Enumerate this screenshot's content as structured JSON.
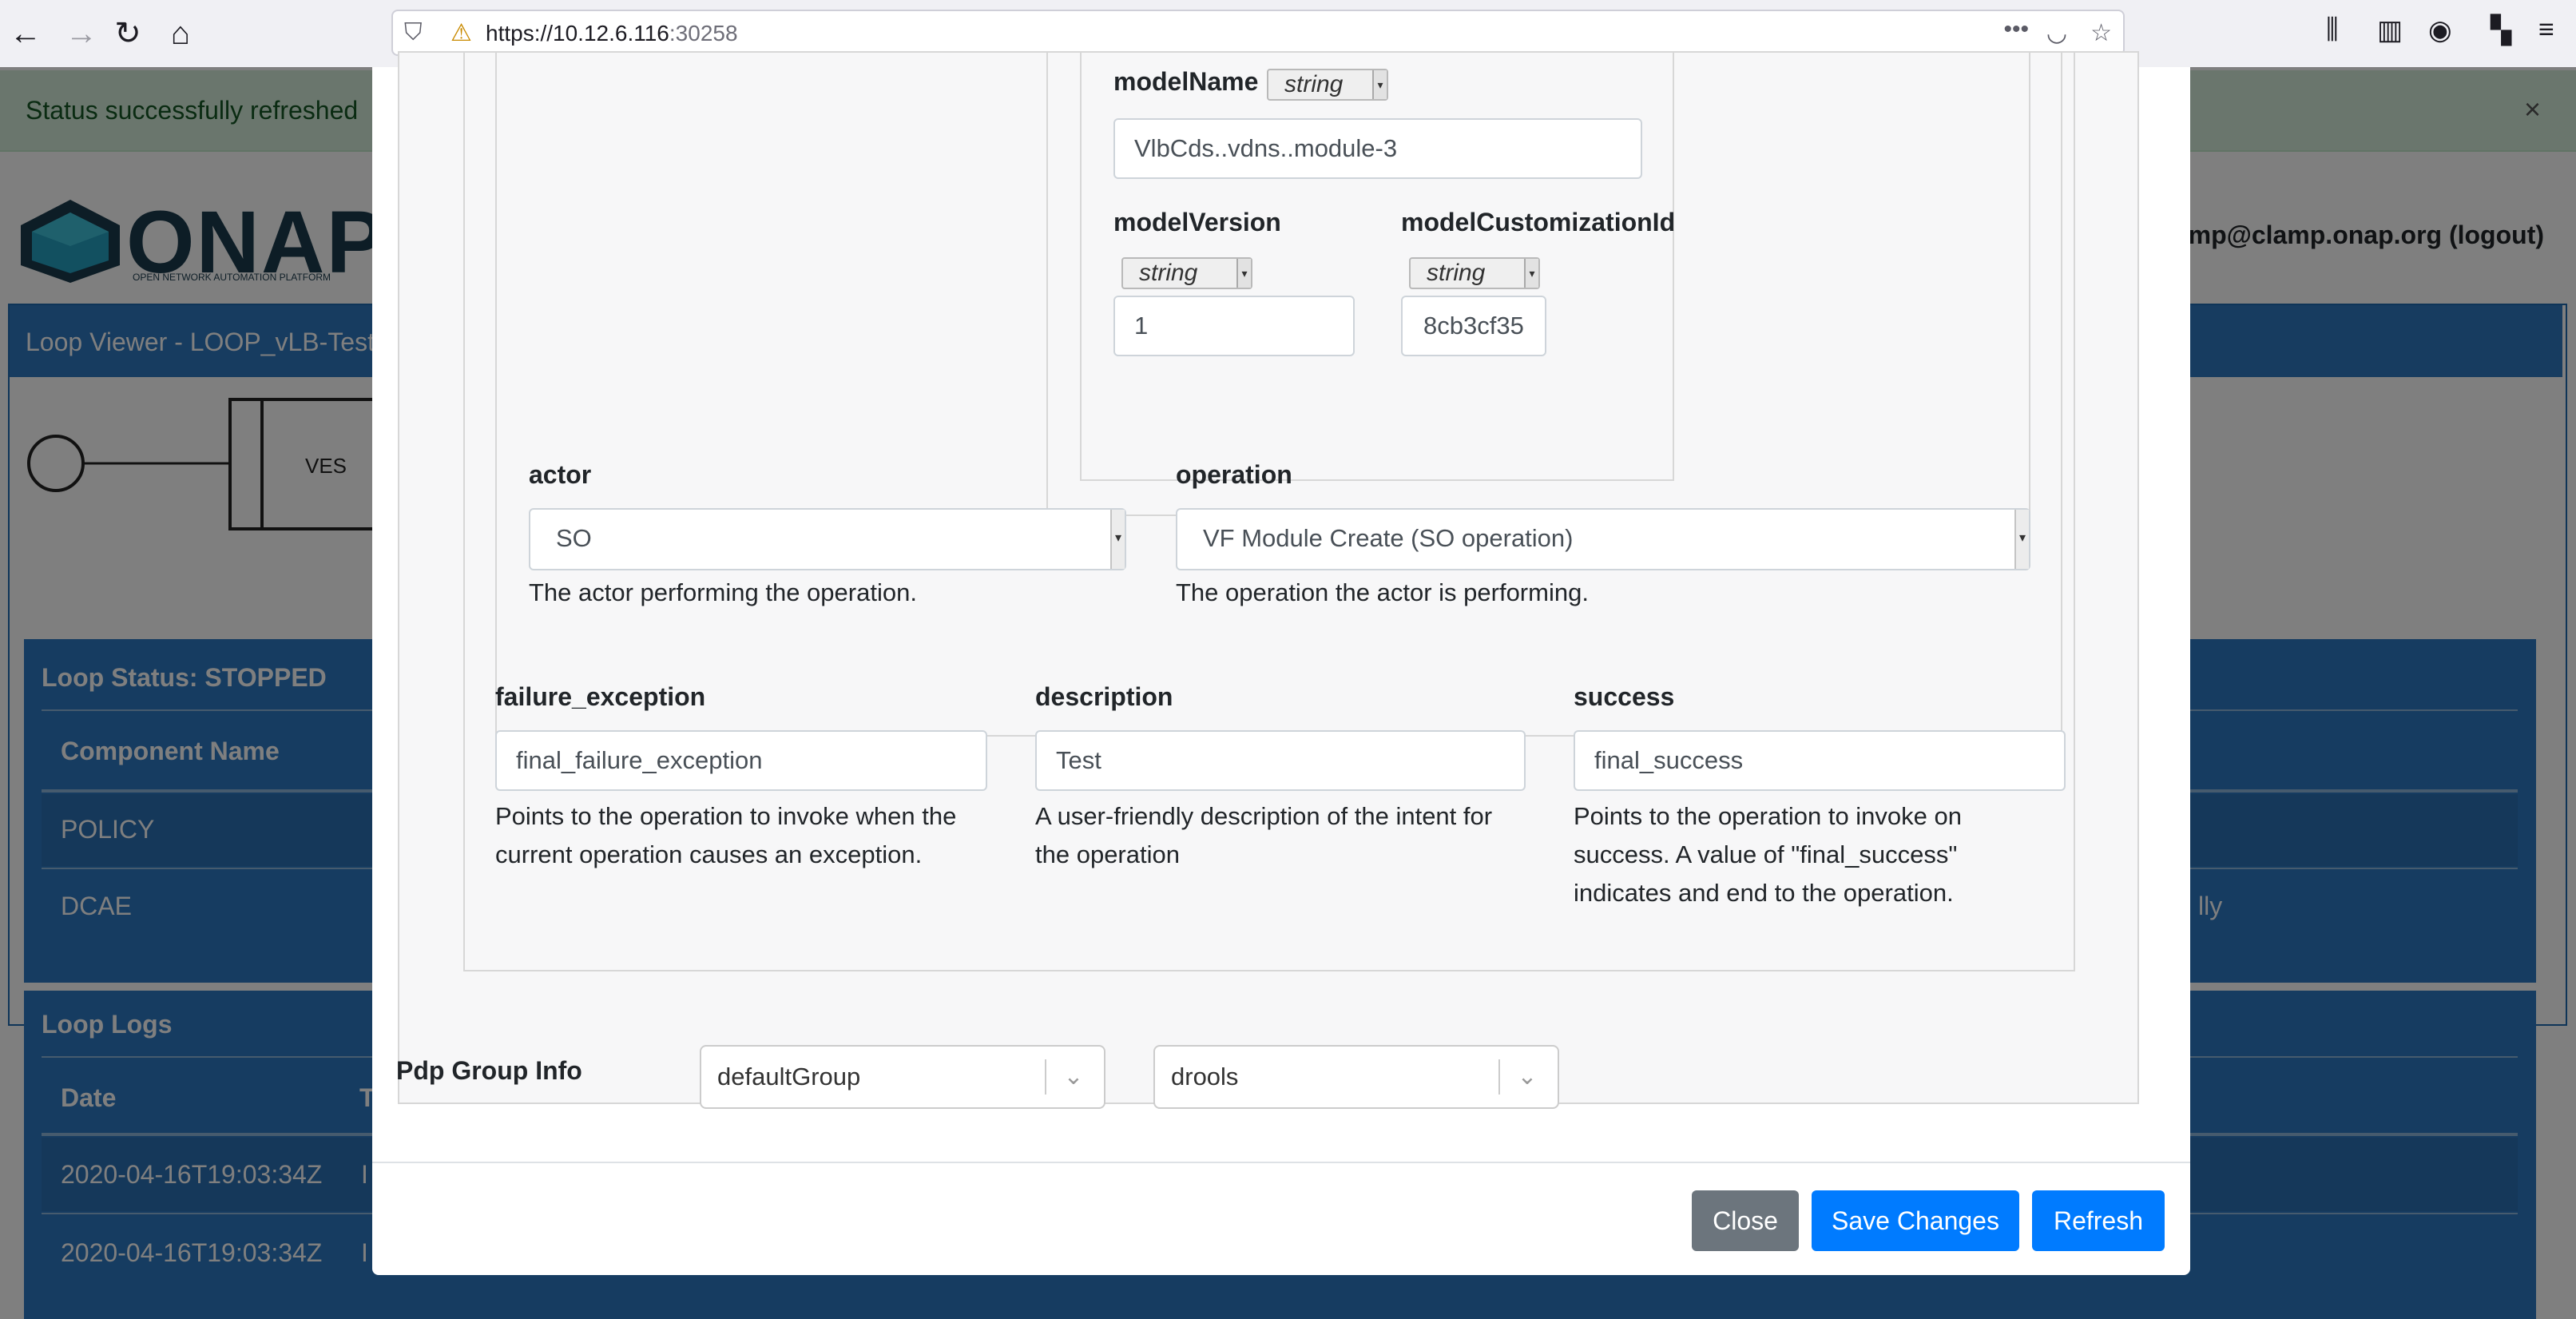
{
  "browser": {
    "url_host": "https://10.12.6.116",
    "url_port": ":30258",
    "icons": {
      "back": "arrow-left-icon",
      "forward": "arrow-right-icon",
      "reload": "reload-icon",
      "home": "home-icon",
      "info": "shield-icon",
      "warning": "lock-warning-icon",
      "more": "more-icon",
      "pocket": "pocket-icon",
      "bookmark": "star-icon",
      "library": "library-icon",
      "sidebar": "sidebar-icon",
      "account": "account-icon",
      "extensions": "extensions-icon",
      "menu": "menu-icon"
    }
  },
  "background": {
    "alert_text": "Status successfully refreshed",
    "alert_close": "×",
    "logo_text": "ONAP",
    "logo_subtext": "OPEN NETWORK AUTOMATION PLATFORM",
    "user_text": "mp@clamp.onap.org (logout)",
    "viewer_title": "Loop Viewer - LOOP_vLB-Test",
    "svg_ves": "VES",
    "status_title": "Loop Status: STOPPED",
    "component_header": "Component Name",
    "rows": [
      "POLICY",
      "DCAE"
    ],
    "dcae_tail": "lly",
    "logs_title": "Loop Logs",
    "logs_date_header": "Date",
    "logs_type_header": "T",
    "log_rows": [
      {
        "date": "2020-04-16T19:03:34Z",
        "type": "I"
      },
      {
        "date": "2020-04-16T19:03:34Z",
        "type": "I"
      }
    ]
  },
  "modal": {
    "model_name": {
      "label": "modelName",
      "type": "string",
      "value": "VlbCds..vdns..module-3"
    },
    "model_version": {
      "label": "modelVersion",
      "type": "string",
      "value": "1"
    },
    "model_customization_id": {
      "label": "modelCustomizationId",
      "type": "string",
      "value": "8cb3cf35"
    },
    "actor": {
      "label": "actor",
      "value": "SO",
      "help": "The actor performing the operation."
    },
    "operation": {
      "label": "operation",
      "value": "VF Module Create (SO operation)",
      "help": "The operation the actor is performing."
    },
    "failure_exception": {
      "label": "failure_exception",
      "value": "final_failure_exception",
      "help_lines": [
        "Points to the operation to invoke when the",
        "current operation causes an exception."
      ]
    },
    "description": {
      "label": "description",
      "value": "Test",
      "help_lines": [
        "A user-friendly description of the intent for",
        "the operation"
      ]
    },
    "success": {
      "label": "success",
      "value": "final_success",
      "help_lines": [
        "Points to the operation to invoke on",
        "success. A value of \"final_success\"",
        "indicates and end to the operation."
      ]
    },
    "pdp_group_label": "Pdp Group Info",
    "pdp_group": "defaultGroup",
    "pdp_subgroup": "drools",
    "buttons": {
      "close": "Close",
      "save": "Save Changes",
      "refresh": "Refresh"
    }
  },
  "colors": {
    "primary": "#007bff",
    "secondary": "#6c757d",
    "alert_bg": "#d4edda",
    "panel_blue": "#2d79c2"
  }
}
